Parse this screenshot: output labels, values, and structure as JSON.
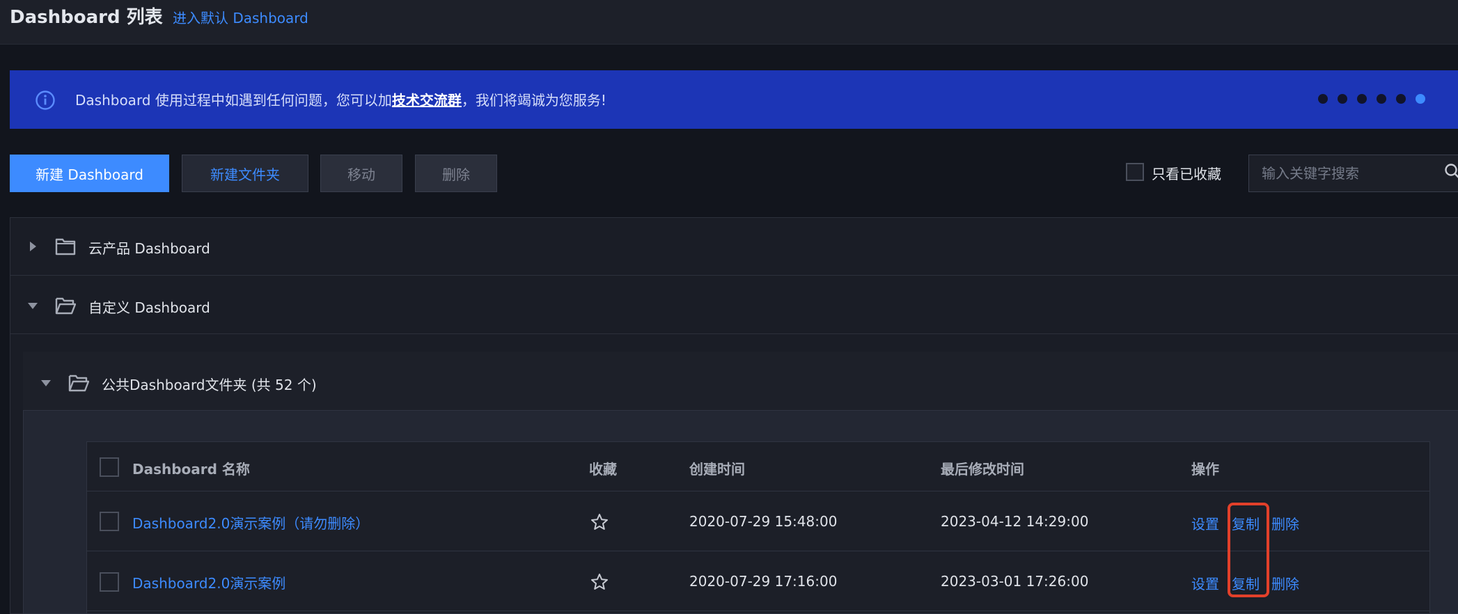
{
  "header": {
    "title": "Dashboard 列表",
    "default_link": "进入默认 Dashboard"
  },
  "banner": {
    "text_before": "Dashboard 使用过程中如遇到任何问题，您可以加",
    "link": "技术交流群",
    "text_after": "，我们将竭诚为您服务!",
    "dot_count": 6,
    "active_dot": 6,
    "color": "#1c35b6"
  },
  "toolbar": {
    "new_dashboard": "新建 Dashboard",
    "new_folder": "新建文件夹",
    "move": "移动",
    "delete": "删除",
    "only_favorites": "只看已收藏",
    "search_placeholder": "输入关键字搜索"
  },
  "folders": [
    {
      "label": "云产品 Dashboard",
      "expanded": false
    },
    {
      "label": "自定义 Dashboard",
      "expanded": true
    }
  ],
  "subfolder": {
    "label": "公共Dashboard文件夹 (共 52 个)",
    "expanded": true
  },
  "table": {
    "columns": [
      "Dashboard 名称",
      "收藏",
      "创建时间",
      "最后修改时间",
      "操作"
    ],
    "rows": [
      {
        "name": "Dashboard2.0演示案例（请勿删除）",
        "favorite": false,
        "created": "2020-07-29 15:48:00",
        "modified": "2023-04-12 14:29:00",
        "actions": [
          "设置",
          "复制",
          "删除"
        ]
      },
      {
        "name": "Dashboard2.0演示案例",
        "favorite": false,
        "created": "2020-07-29 17:16:00",
        "modified": "2023-03-01 17:26:00",
        "actions": [
          "设置",
          "复制",
          "删除"
        ]
      }
    ]
  },
  "colors": {
    "accent": "#3d8bff",
    "highlight": "#e2402a",
    "background": "#12151d"
  }
}
